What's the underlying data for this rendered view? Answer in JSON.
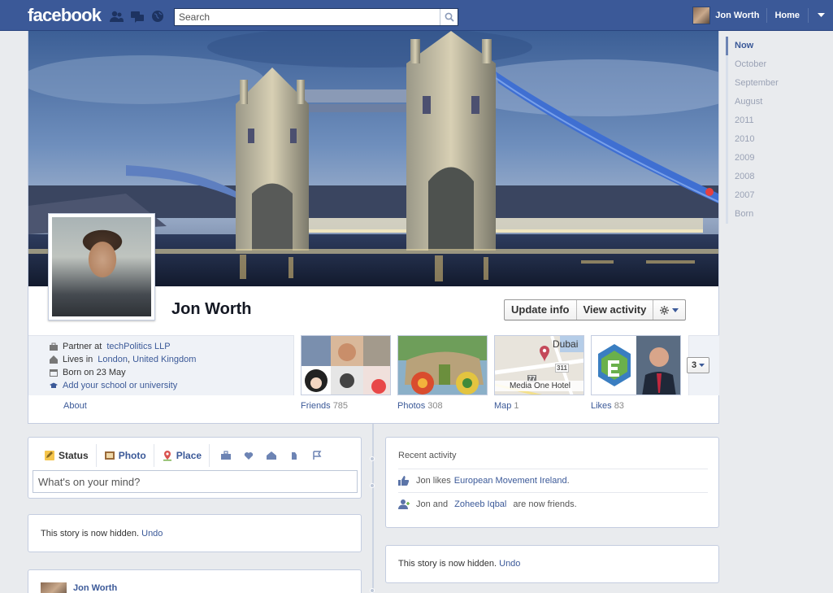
{
  "header": {
    "logo": "facebook",
    "search_placeholder": "Search",
    "user_name": "Jon Worth",
    "home_label": "Home"
  },
  "profile": {
    "name": "Jon Worth",
    "buttons": {
      "update_info": "Update info",
      "view_activity": "View activity"
    },
    "info": {
      "work_prefix": "Partner at",
      "work_link": "techPolitics LLP",
      "lives_prefix": "Lives in",
      "lives_city": "London",
      "lives_country": "United Kingdom",
      "born": "Born on 23 May",
      "school_link": "Add your school or university"
    },
    "about_label": "About",
    "apps": [
      {
        "label": "Friends",
        "count": "785"
      },
      {
        "label": "Photos",
        "count": "308"
      },
      {
        "label": "Map",
        "count": "1",
        "map_city": "Dubai",
        "map_place": "Media One Hotel",
        "map_road1": "311",
        "map_road2": "77"
      },
      {
        "label": "Likes",
        "count": "83"
      }
    ],
    "more_count": "3"
  },
  "timeline_nav": [
    "Now",
    "October",
    "September",
    "August",
    "2011",
    "2010",
    "2009",
    "2008",
    "2007",
    "Born"
  ],
  "composer": {
    "tabs": [
      {
        "label": "Status"
      },
      {
        "label": "Photo"
      },
      {
        "label": "Place"
      }
    ],
    "placeholder": "What's on your mind?"
  },
  "hidden_story": {
    "text": "This story is now hidden.",
    "undo": "Undo"
  },
  "recent_activity": {
    "title": "Recent activity",
    "row1": {
      "prefix": "Jon likes",
      "link": "European Movement Ireland",
      "suffix": "."
    },
    "row2": {
      "prefix": "Jon and",
      "link": "Zoheeb Iqbal",
      "suffix": "are now friends."
    }
  },
  "post_author": "Jon Worth",
  "colors": {
    "brand": "#3b5998",
    "background": "#e9ebee",
    "link": "#3b5998"
  }
}
